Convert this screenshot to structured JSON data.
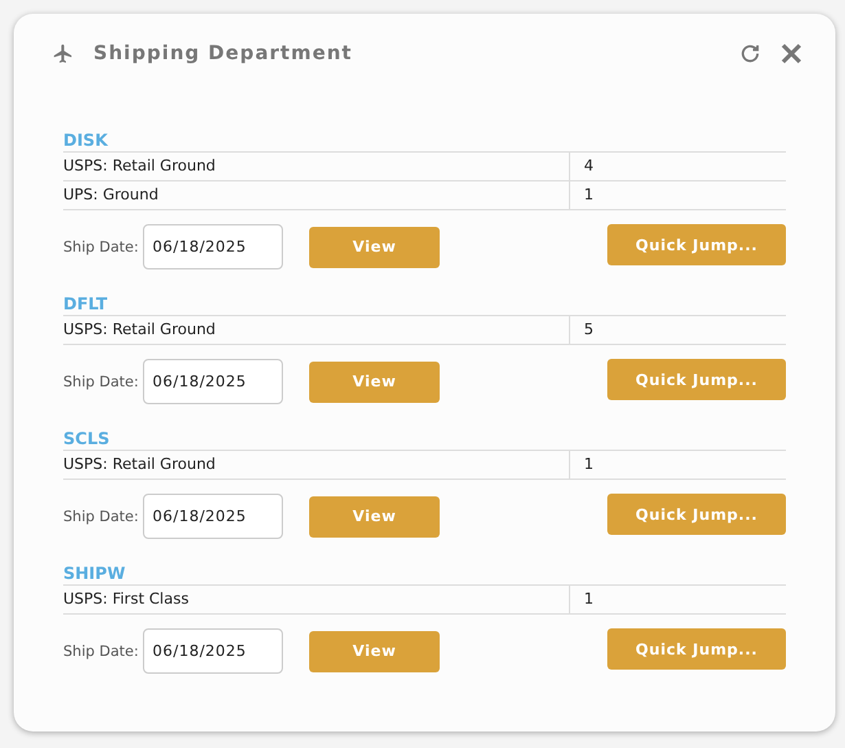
{
  "window": {
    "title": "Shipping Department"
  },
  "sections": [
    {
      "name": "DISK",
      "rows": [
        {
          "method": "USPS: Retail Ground",
          "count": "4"
        },
        {
          "method": "UPS: Ground",
          "count": "1"
        }
      ],
      "date_label": "Ship Date:",
      "date": "06/18/2025",
      "view": "View",
      "jump": "Quick Jump..."
    },
    {
      "name": "DFLT",
      "rows": [
        {
          "method": "USPS: Retail Ground",
          "count": "5"
        }
      ],
      "date_label": "Ship Date:",
      "date": "06/18/2025",
      "view": "View",
      "jump": "Quick Jump..."
    },
    {
      "name": "SCLS",
      "rows": [
        {
          "method": "USPS: Retail Ground",
          "count": "1"
        }
      ],
      "date_label": "Ship Date:",
      "date": "06/18/2025",
      "view": "View",
      "jump": "Quick Jump..."
    },
    {
      "name": "SHIPW",
      "rows": [
        {
          "method": "USPS: First Class",
          "count": "1"
        }
      ],
      "date_label": "Ship Date:",
      "date": "06/18/2025",
      "view": "View",
      "jump": "Quick Jump..."
    }
  ]
}
